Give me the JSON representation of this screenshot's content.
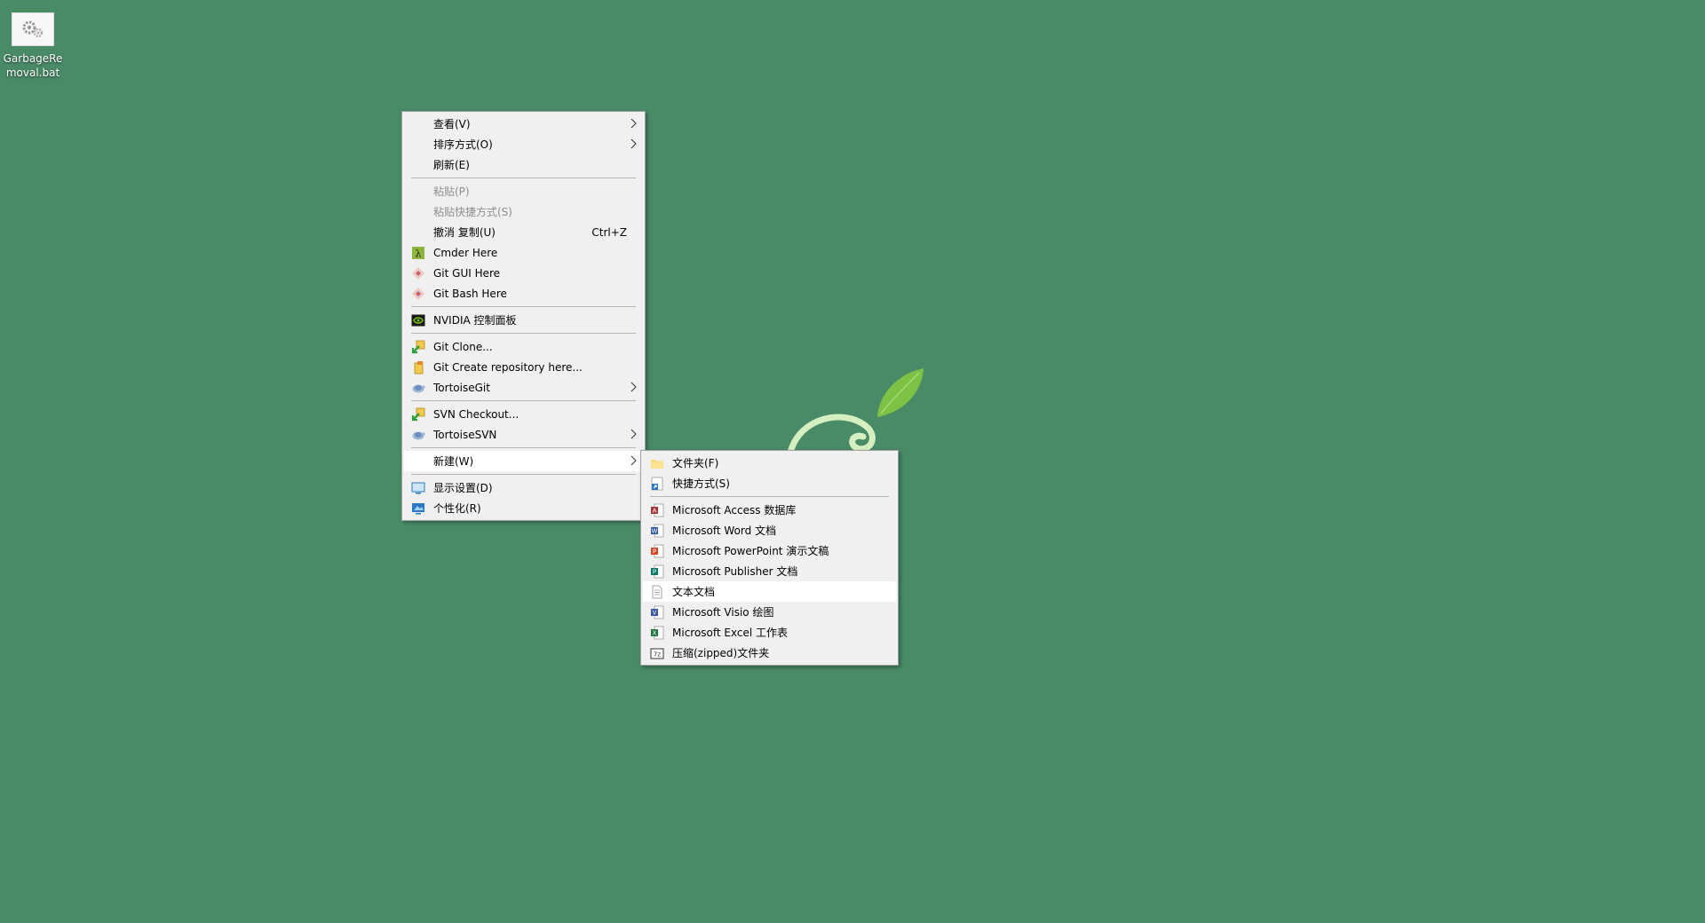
{
  "desktop": {
    "background_color": "#498b67",
    "icon": {
      "label": "GarbageRemoval.bat",
      "icon": "gear-icon"
    }
  },
  "context_menu": {
    "items": [
      {
        "label": "查看(V)",
        "submenu": true
      },
      {
        "label": "排序方式(O)",
        "submenu": true
      },
      {
        "label": "刷新(E)"
      },
      {
        "label": "粘贴(P)",
        "disabled": true
      },
      {
        "label": "粘贴快捷方式(S)",
        "disabled": true
      },
      {
        "label": "撤消 复制(U)",
        "shortcut": "Ctrl+Z"
      },
      {
        "label": "Cmder Here",
        "icon": "lambda-icon"
      },
      {
        "label": "Git GUI Here",
        "icon": "git-icon"
      },
      {
        "label": "Git Bash Here",
        "icon": "git-icon"
      },
      {
        "label": "NVIDIA 控制面板",
        "icon": "nvidia-icon"
      },
      {
        "label": "Git Clone...",
        "icon": "git-clone-icon"
      },
      {
        "label": "Git Create repository here...",
        "icon": "git-create-repo-icon"
      },
      {
        "label": "TortoiseGit",
        "icon": "tortoise-icon",
        "submenu": true
      },
      {
        "label": "SVN Checkout...",
        "icon": "svn-checkout-icon"
      },
      {
        "label": "TortoiseSVN",
        "icon": "tortoise-icon",
        "submenu": true
      },
      {
        "label": "新建(W)",
        "submenu": true,
        "highlighted": true
      },
      {
        "label": "显示设置(D)",
        "icon": "display-icon"
      },
      {
        "label": "个性化(R)",
        "icon": "personalize-icon"
      }
    ]
  },
  "new_submenu": {
    "items": [
      {
        "label": "文件夹(F)",
        "icon": "folder-icon"
      },
      {
        "label": "快捷方式(S)",
        "icon": "shortcut-icon"
      },
      {
        "label": "Microsoft Access 数据库",
        "icon": "access-icon"
      },
      {
        "label": "Microsoft Word 文档",
        "icon": "word-icon"
      },
      {
        "label": "Microsoft PowerPoint 演示文稿",
        "icon": "powerpoint-icon"
      },
      {
        "label": "Microsoft Publisher 文档",
        "icon": "publisher-icon"
      },
      {
        "label": "文本文档",
        "icon": "text-document-icon",
        "highlighted": true
      },
      {
        "label": "Microsoft Visio 绘图",
        "icon": "visio-icon"
      },
      {
        "label": "Microsoft Excel 工作表",
        "icon": "excel-icon"
      },
      {
        "label": "压缩(zipped)文件夹",
        "icon": "zip-folder-icon"
      }
    ]
  },
  "colors": {
    "menu_bg": "#f0f0f0",
    "menu_hover": "#ffffff",
    "disabled_text": "#8e8e8e",
    "git": "#f05033",
    "nvidia": "#76b900"
  }
}
